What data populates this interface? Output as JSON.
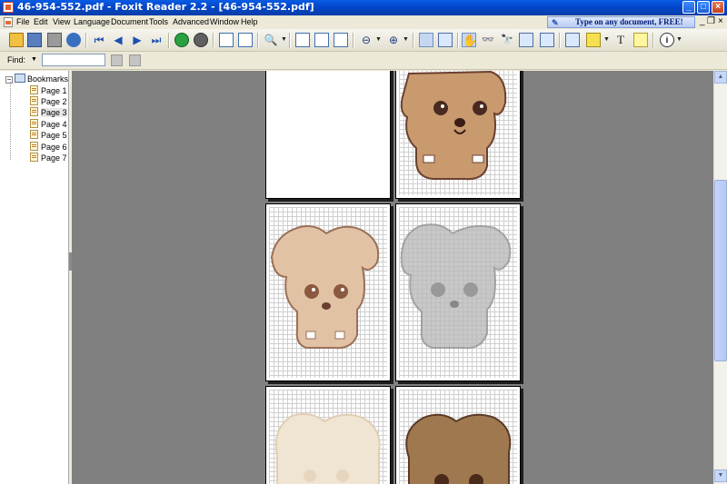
{
  "window": {
    "title": "46-954-552.pdf - Foxit Reader 2.2 - [46-954-552.pdf]",
    "controls": {
      "minimize": "_",
      "maximize": "□",
      "close": "×"
    }
  },
  "menu": {
    "items": [
      "File",
      "Edit",
      "View",
      "Language",
      "Document",
      "Tools",
      "Advanced",
      "Window",
      "Help"
    ],
    "promo": "Type on any document, FREE!",
    "mdi_controls": {
      "minimize": "_",
      "restore": "❐",
      "close": "×"
    }
  },
  "toolbar": {
    "icons": [
      "open-icon",
      "save-icon",
      "print-icon",
      "email-icon",
      "first-page-icon",
      "previous-page-icon",
      "next-page-icon",
      "last-page-icon",
      "go-back-icon",
      "go-forward-icon",
      "rotate-left-icon",
      "rotate-right-icon",
      "zoom-in-icon",
      "actual-size-icon",
      "fit-page-icon",
      "fit-width-icon",
      "zoom-out-icon",
      "zoom-in-plus-icon",
      "single-page-icon",
      "continuous-icon",
      "hand-tool-icon",
      "snapshot-icon",
      "find-icon",
      "select-text-icon",
      "select-image-icon",
      "typewriter-icon",
      "highlight-icon",
      "text-tool-icon",
      "note-icon",
      "info-icon"
    ]
  },
  "findbar": {
    "label": "Find:",
    "value": "",
    "placeholder": ""
  },
  "sidebar": {
    "root_label": "Bookmarks",
    "expander": "−",
    "items": [
      {
        "label": "Page 1"
      },
      {
        "label": "Page 2"
      },
      {
        "label": "Page 3"
      },
      {
        "label": "Page 4"
      },
      {
        "label": "Page 5"
      },
      {
        "label": "Page 6"
      },
      {
        "label": "Page 7"
      }
    ],
    "selected_index": 2
  },
  "document": {
    "background": "#808080",
    "pages": [
      {
        "name": "blank-page",
        "tone": "none"
      },
      {
        "name": "puppy-page-color",
        "tone": "#c99a6e"
      },
      {
        "name": "puppy-page-light",
        "tone": "#e2c2a4"
      },
      {
        "name": "puppy-page-gray",
        "tone": "#bbbbbb"
      },
      {
        "name": "puppy-page-faint",
        "tone": "#f0e4d2"
      },
      {
        "name": "puppy-page-dark",
        "tone": "#a07850"
      }
    ]
  },
  "scrollbar": {
    "up": "▲",
    "down": "▼"
  }
}
